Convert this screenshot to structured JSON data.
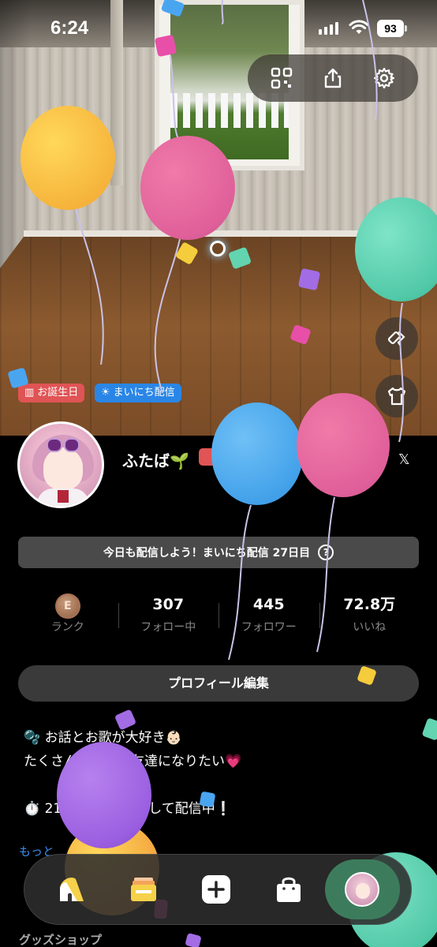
{
  "status_bar": {
    "time": "6:24",
    "battery": "93"
  },
  "top_actions": {
    "qr_icon": "qr-code-icon",
    "share_icon": "share-icon",
    "settings_icon": "gear-icon"
  },
  "side_actions": {
    "paint_icon": "paint-roller-icon",
    "outfit_icon": "tshirt-icon"
  },
  "tags": {
    "birthday": "お誕生日",
    "daily": "まいにち配信"
  },
  "profile": {
    "name": "ふたば🌱",
    "streak_banner": "今日も配信しよう！まいにち配信 27日目",
    "info_icon_glyph": "?",
    "x_link": "𝕏"
  },
  "stats": {
    "rank_value": "E",
    "rank_label": "ランク",
    "following_value": "307",
    "following_label": "フォロー中",
    "followers_value": "445",
    "followers_label": "フォロワー",
    "likes_value": "72.8万",
    "likes_label": "いいね"
  },
  "edit_profile_label": "プロフィール編集",
  "bio": {
    "line1": "🫧 お話とお歌が大好き👶🏻",
    "line2": "たくさんの人とお友達になりたい💗",
    "line3": "⏱️ 21",
    "line3_tail": "して配信中❕",
    "more_link": "もっと",
    "section_goods": "グッズショップ"
  },
  "bottom_nav": {
    "home_icon": "home-icon",
    "cards_icon": "cards-icon",
    "create_icon": "plus-icon",
    "shop_icon": "shopping-bag-icon",
    "profile_icon": "avatar"
  },
  "colors": {
    "birthday_tag": "#e05455",
    "daily_tag": "#2a86e6",
    "link": "#3c8cf0",
    "nav_active": "#3c7c5c"
  }
}
